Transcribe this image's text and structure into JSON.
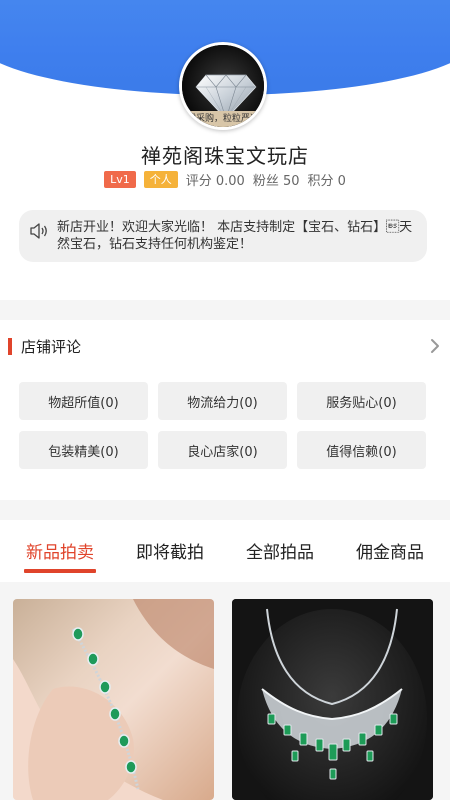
{
  "shop": {
    "avatar_caption": "球采购，粒粒严选",
    "name": "禅苑阁珠宝文玩店",
    "level_badge": "Lv1",
    "type_badge": "个人",
    "rating": "评分 0.00",
    "fans": "粉丝 50",
    "points": "积分 0",
    "notice": "新店开业！欢迎大家光临！ 本店支持制定【宝石、钻石】\b天然宝石，钻石支持任何机构鉴定！",
    "accent_color": "#3f7fee"
  },
  "reviews": {
    "title": "店铺评论",
    "tags": [
      "物超所值(0)",
      "物流给力(0)",
      "服务贴心(0)",
      "包装精美(0)",
      "良心店家(0)",
      "值得信赖(0)"
    ],
    "accent_color": "#e0442b"
  },
  "tabs": [
    {
      "label": "新品拍卖",
      "active": true
    },
    {
      "label": "即将截拍",
      "active": false
    },
    {
      "label": "全部拍品",
      "active": false
    },
    {
      "label": "佣金商品",
      "active": false
    }
  ],
  "products": [
    {
      "image": "emerald-bracelet-photo"
    },
    {
      "image": "emerald-necklace-photo"
    }
  ],
  "icons": {
    "notice": "speaker-icon",
    "more": "chevron-right-icon"
  }
}
